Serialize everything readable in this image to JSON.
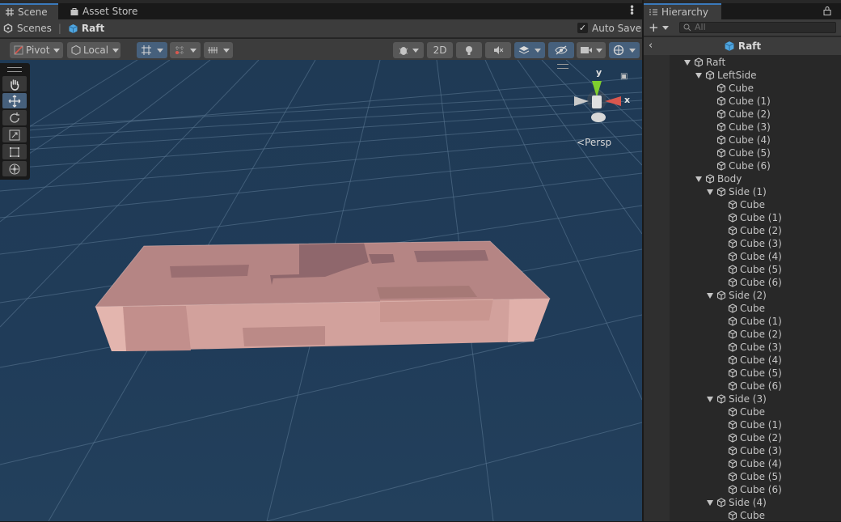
{
  "scene_window": {
    "tabs": [
      {
        "label": "Scene",
        "icon": "grid-icon",
        "active": true
      },
      {
        "label": "Asset Store",
        "icon": "bag-icon",
        "active": false
      }
    ],
    "breadcrumb": {
      "scenes": "Scenes",
      "current": "Raft"
    },
    "auto_save_label": "Auto Save",
    "auto_save_checked": true,
    "toolbar": {
      "pivot_label": "Pivot",
      "local_label": "Local",
      "mode_2d_label": "2D"
    },
    "gizmo": {
      "x": "x",
      "y": "y",
      "persp": "Persp"
    }
  },
  "hierarchy": {
    "tab_label": "Hierarchy",
    "search_placeholder": "All",
    "header": "Raft",
    "tree": [
      {
        "label": "Raft",
        "depth": 0,
        "expandable": true
      },
      {
        "label": "LeftSide",
        "depth": 1,
        "expandable": true
      },
      {
        "label": "Cube",
        "depth": 2,
        "expandable": false
      },
      {
        "label": "Cube (1)",
        "depth": 2,
        "expandable": false
      },
      {
        "label": "Cube (2)",
        "depth": 2,
        "expandable": false
      },
      {
        "label": "Cube (3)",
        "depth": 2,
        "expandable": false
      },
      {
        "label": "Cube (4)",
        "depth": 2,
        "expandable": false
      },
      {
        "label": "Cube (5)",
        "depth": 2,
        "expandable": false
      },
      {
        "label": "Cube (6)",
        "depth": 2,
        "expandable": false
      },
      {
        "label": "Body",
        "depth": 1,
        "expandable": true
      },
      {
        "label": "Side (1)",
        "depth": 2,
        "expandable": true
      },
      {
        "label": "Cube",
        "depth": 3,
        "expandable": false
      },
      {
        "label": "Cube (1)",
        "depth": 3,
        "expandable": false
      },
      {
        "label": "Cube (2)",
        "depth": 3,
        "expandable": false
      },
      {
        "label": "Cube (3)",
        "depth": 3,
        "expandable": false
      },
      {
        "label": "Cube (4)",
        "depth": 3,
        "expandable": false
      },
      {
        "label": "Cube (5)",
        "depth": 3,
        "expandable": false
      },
      {
        "label": "Cube (6)",
        "depth": 3,
        "expandable": false
      },
      {
        "label": "Side (2)",
        "depth": 2,
        "expandable": true
      },
      {
        "label": "Cube",
        "depth": 3,
        "expandable": false
      },
      {
        "label": "Cube (1)",
        "depth": 3,
        "expandable": false
      },
      {
        "label": "Cube (2)",
        "depth": 3,
        "expandable": false
      },
      {
        "label": "Cube (3)",
        "depth": 3,
        "expandable": false
      },
      {
        "label": "Cube (4)",
        "depth": 3,
        "expandable": false
      },
      {
        "label": "Cube (5)",
        "depth": 3,
        "expandable": false
      },
      {
        "label": "Cube (6)",
        "depth": 3,
        "expandable": false
      },
      {
        "label": "Side (3)",
        "depth": 2,
        "expandable": true
      },
      {
        "label": "Cube",
        "depth": 3,
        "expandable": false
      },
      {
        "label": "Cube (1)",
        "depth": 3,
        "expandable": false
      },
      {
        "label": "Cube (2)",
        "depth": 3,
        "expandable": false
      },
      {
        "label": "Cube (3)",
        "depth": 3,
        "expandable": false
      },
      {
        "label": "Cube (4)",
        "depth": 3,
        "expandable": false
      },
      {
        "label": "Cube (5)",
        "depth": 3,
        "expandable": false
      },
      {
        "label": "Cube (6)",
        "depth": 3,
        "expandable": false
      },
      {
        "label": "Side (4)",
        "depth": 2,
        "expandable": true
      },
      {
        "label": "Cube",
        "depth": 3,
        "expandable": false
      }
    ]
  },
  "colors": {
    "accent": "#46607c",
    "raft": "#d9a7a2",
    "panel": "#3c3c3c"
  }
}
